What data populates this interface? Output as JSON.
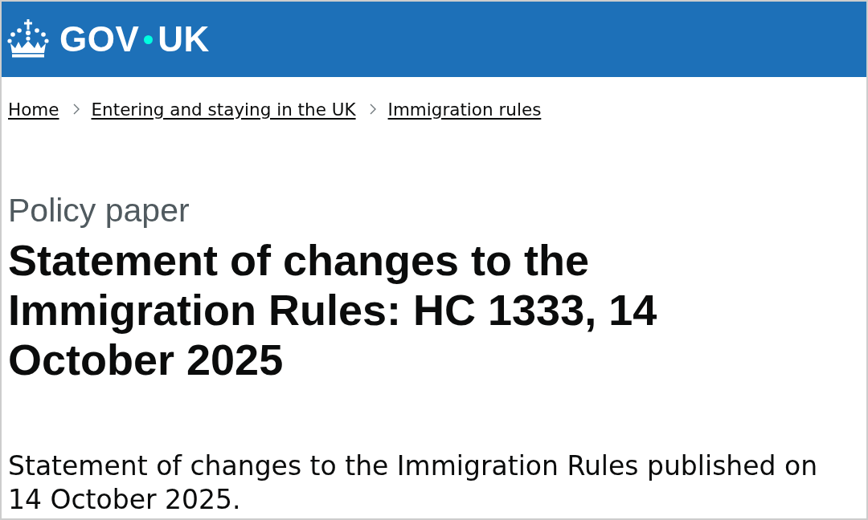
{
  "header": {
    "logo": {
      "parts": [
        "GOV",
        "UK"
      ]
    }
  },
  "breadcrumbs": [
    {
      "label": "Home"
    },
    {
      "label": "Entering and staying in the UK"
    },
    {
      "label": "Immigration rules"
    }
  ],
  "caption": "Policy paper",
  "title": "Statement of changes to the Immigration Rules: HC 1333, 14 October 2025",
  "summary": "Statement of changes to the Immigration Rules published on 14 October 2025."
}
